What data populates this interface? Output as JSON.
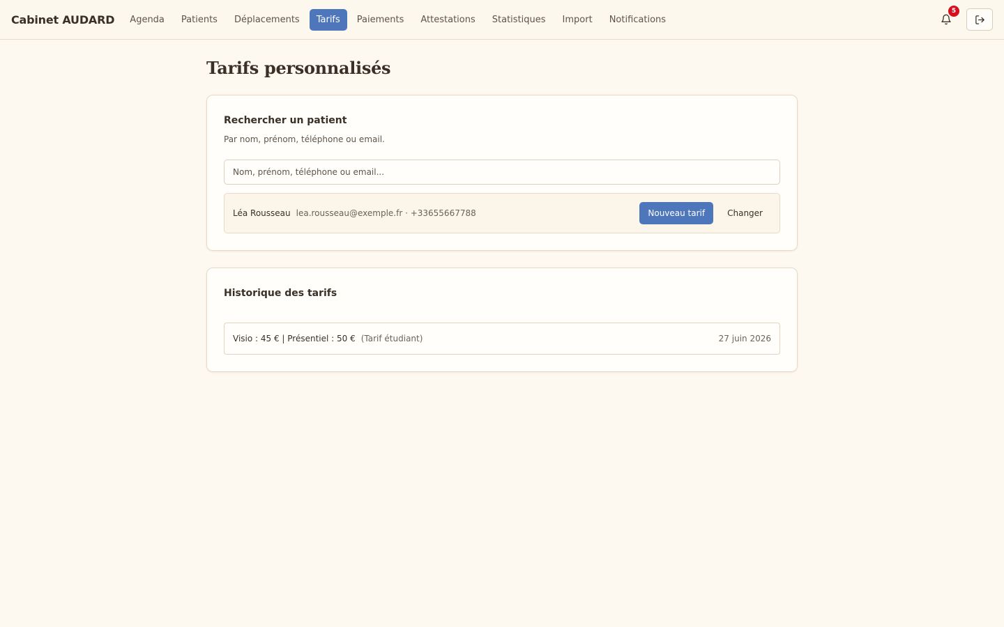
{
  "header": {
    "brand": "Cabinet AUDARD",
    "nav": [
      {
        "label": "Agenda",
        "active": false
      },
      {
        "label": "Patients",
        "active": false
      },
      {
        "label": "Déplacements",
        "active": false
      },
      {
        "label": "Tarifs",
        "active": true
      },
      {
        "label": "Paiements",
        "active": false
      },
      {
        "label": "Attestations",
        "active": false
      },
      {
        "label": "Statistiques",
        "active": false
      },
      {
        "label": "Import",
        "active": false
      },
      {
        "label": "Notifications",
        "active": false
      }
    ],
    "notification_count": "5",
    "icons": {
      "notifications": "bell-icon",
      "logout": "logout-icon"
    }
  },
  "page": {
    "title": "Tarifs personnalisés"
  },
  "search_card": {
    "title": "Rechercher un patient",
    "subtitle": "Par nom, prénom, téléphone ou email.",
    "placeholder": "Nom, prénom, téléphone ou email...",
    "value": "",
    "selected_patient": {
      "name": "Léa Rousseau",
      "contact": "lea.rousseau@exemple.fr · +33655667788",
      "new_tarif_label": "Nouveau tarif",
      "change_label": "Changer"
    }
  },
  "history_card": {
    "title": "Historique des tarifs",
    "entries": [
      {
        "tarif": "Visio : 45 € | Présentiel : 50 €",
        "note": "(Tarif étudiant)",
        "date": "27 juin 2026"
      }
    ]
  },
  "colors": {
    "accent": "#4e77bb",
    "background": "#fdf8f0",
    "badge": "#d6101e"
  }
}
